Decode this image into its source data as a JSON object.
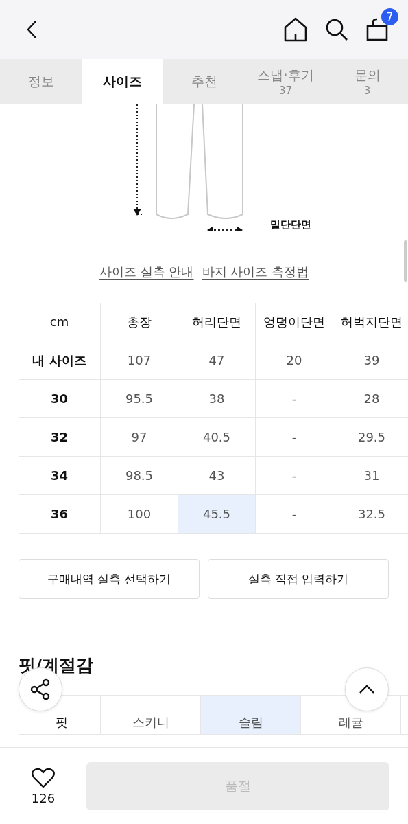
{
  "header": {
    "cart_count": "7"
  },
  "tabs": [
    {
      "label": "정보",
      "selected": false
    },
    {
      "label": "사이즈",
      "selected": true
    },
    {
      "label": "추천",
      "selected": false
    },
    {
      "label": "스냅·후기",
      "count": "37",
      "selected": false
    },
    {
      "label": "문의",
      "count": "3",
      "selected": false
    }
  ],
  "illustration": {
    "hem_label": "밑단단면"
  },
  "links": [
    "사이즈 실측 안내",
    "바지 사이즈 측정법"
  ],
  "size_table": {
    "columns": [
      "cm",
      "총장",
      "허리단면",
      "엉덩이단면",
      "허벅지단면"
    ],
    "rows": [
      {
        "cells": [
          {
            "text": "내 사이즈",
            "highlighted": false
          },
          {
            "text": "107",
            "highlighted": false
          },
          {
            "text": "47",
            "highlighted": false
          },
          {
            "text": "20",
            "highlighted": false
          },
          {
            "text": "39",
            "highlighted": false
          }
        ]
      },
      {
        "cells": [
          {
            "text": "30",
            "highlighted": false
          },
          {
            "text": "95.5",
            "highlighted": false
          },
          {
            "text": "38",
            "highlighted": false
          },
          {
            "text": "-",
            "highlighted": false
          },
          {
            "text": "28",
            "highlighted": false
          }
        ]
      },
      {
        "cells": [
          {
            "text": "32",
            "highlighted": false
          },
          {
            "text": "97",
            "highlighted": false
          },
          {
            "text": "40.5",
            "highlighted": false
          },
          {
            "text": "-",
            "highlighted": false
          },
          {
            "text": "29.5",
            "highlighted": false
          }
        ]
      },
      {
        "cells": [
          {
            "text": "34",
            "highlighted": false
          },
          {
            "text": "98.5",
            "highlighted": false
          },
          {
            "text": "43",
            "highlighted": false
          },
          {
            "text": "-",
            "highlighted": false
          },
          {
            "text": "31",
            "highlighted": false
          }
        ]
      },
      {
        "cells": [
          {
            "text": "36",
            "highlighted": false
          },
          {
            "text": "100",
            "highlighted": false
          },
          {
            "text": "45.5",
            "highlighted": true
          },
          {
            "text": "-",
            "highlighted": false
          },
          {
            "text": "32.5",
            "highlighted": false
          }
        ]
      }
    ]
  },
  "actions": [
    "구매내역 실측 선택하기",
    "실측 직접 입력하기"
  ],
  "fit_section": {
    "title": "핏/계절감",
    "label": "핏",
    "options": [
      {
        "label": "스키니",
        "selected": false
      },
      {
        "label": "슬림",
        "selected": true
      },
      {
        "label": "레귤",
        "selected": false
      }
    ]
  },
  "bottom_bar": {
    "like_count": "126",
    "buy_button": "품절"
  }
}
